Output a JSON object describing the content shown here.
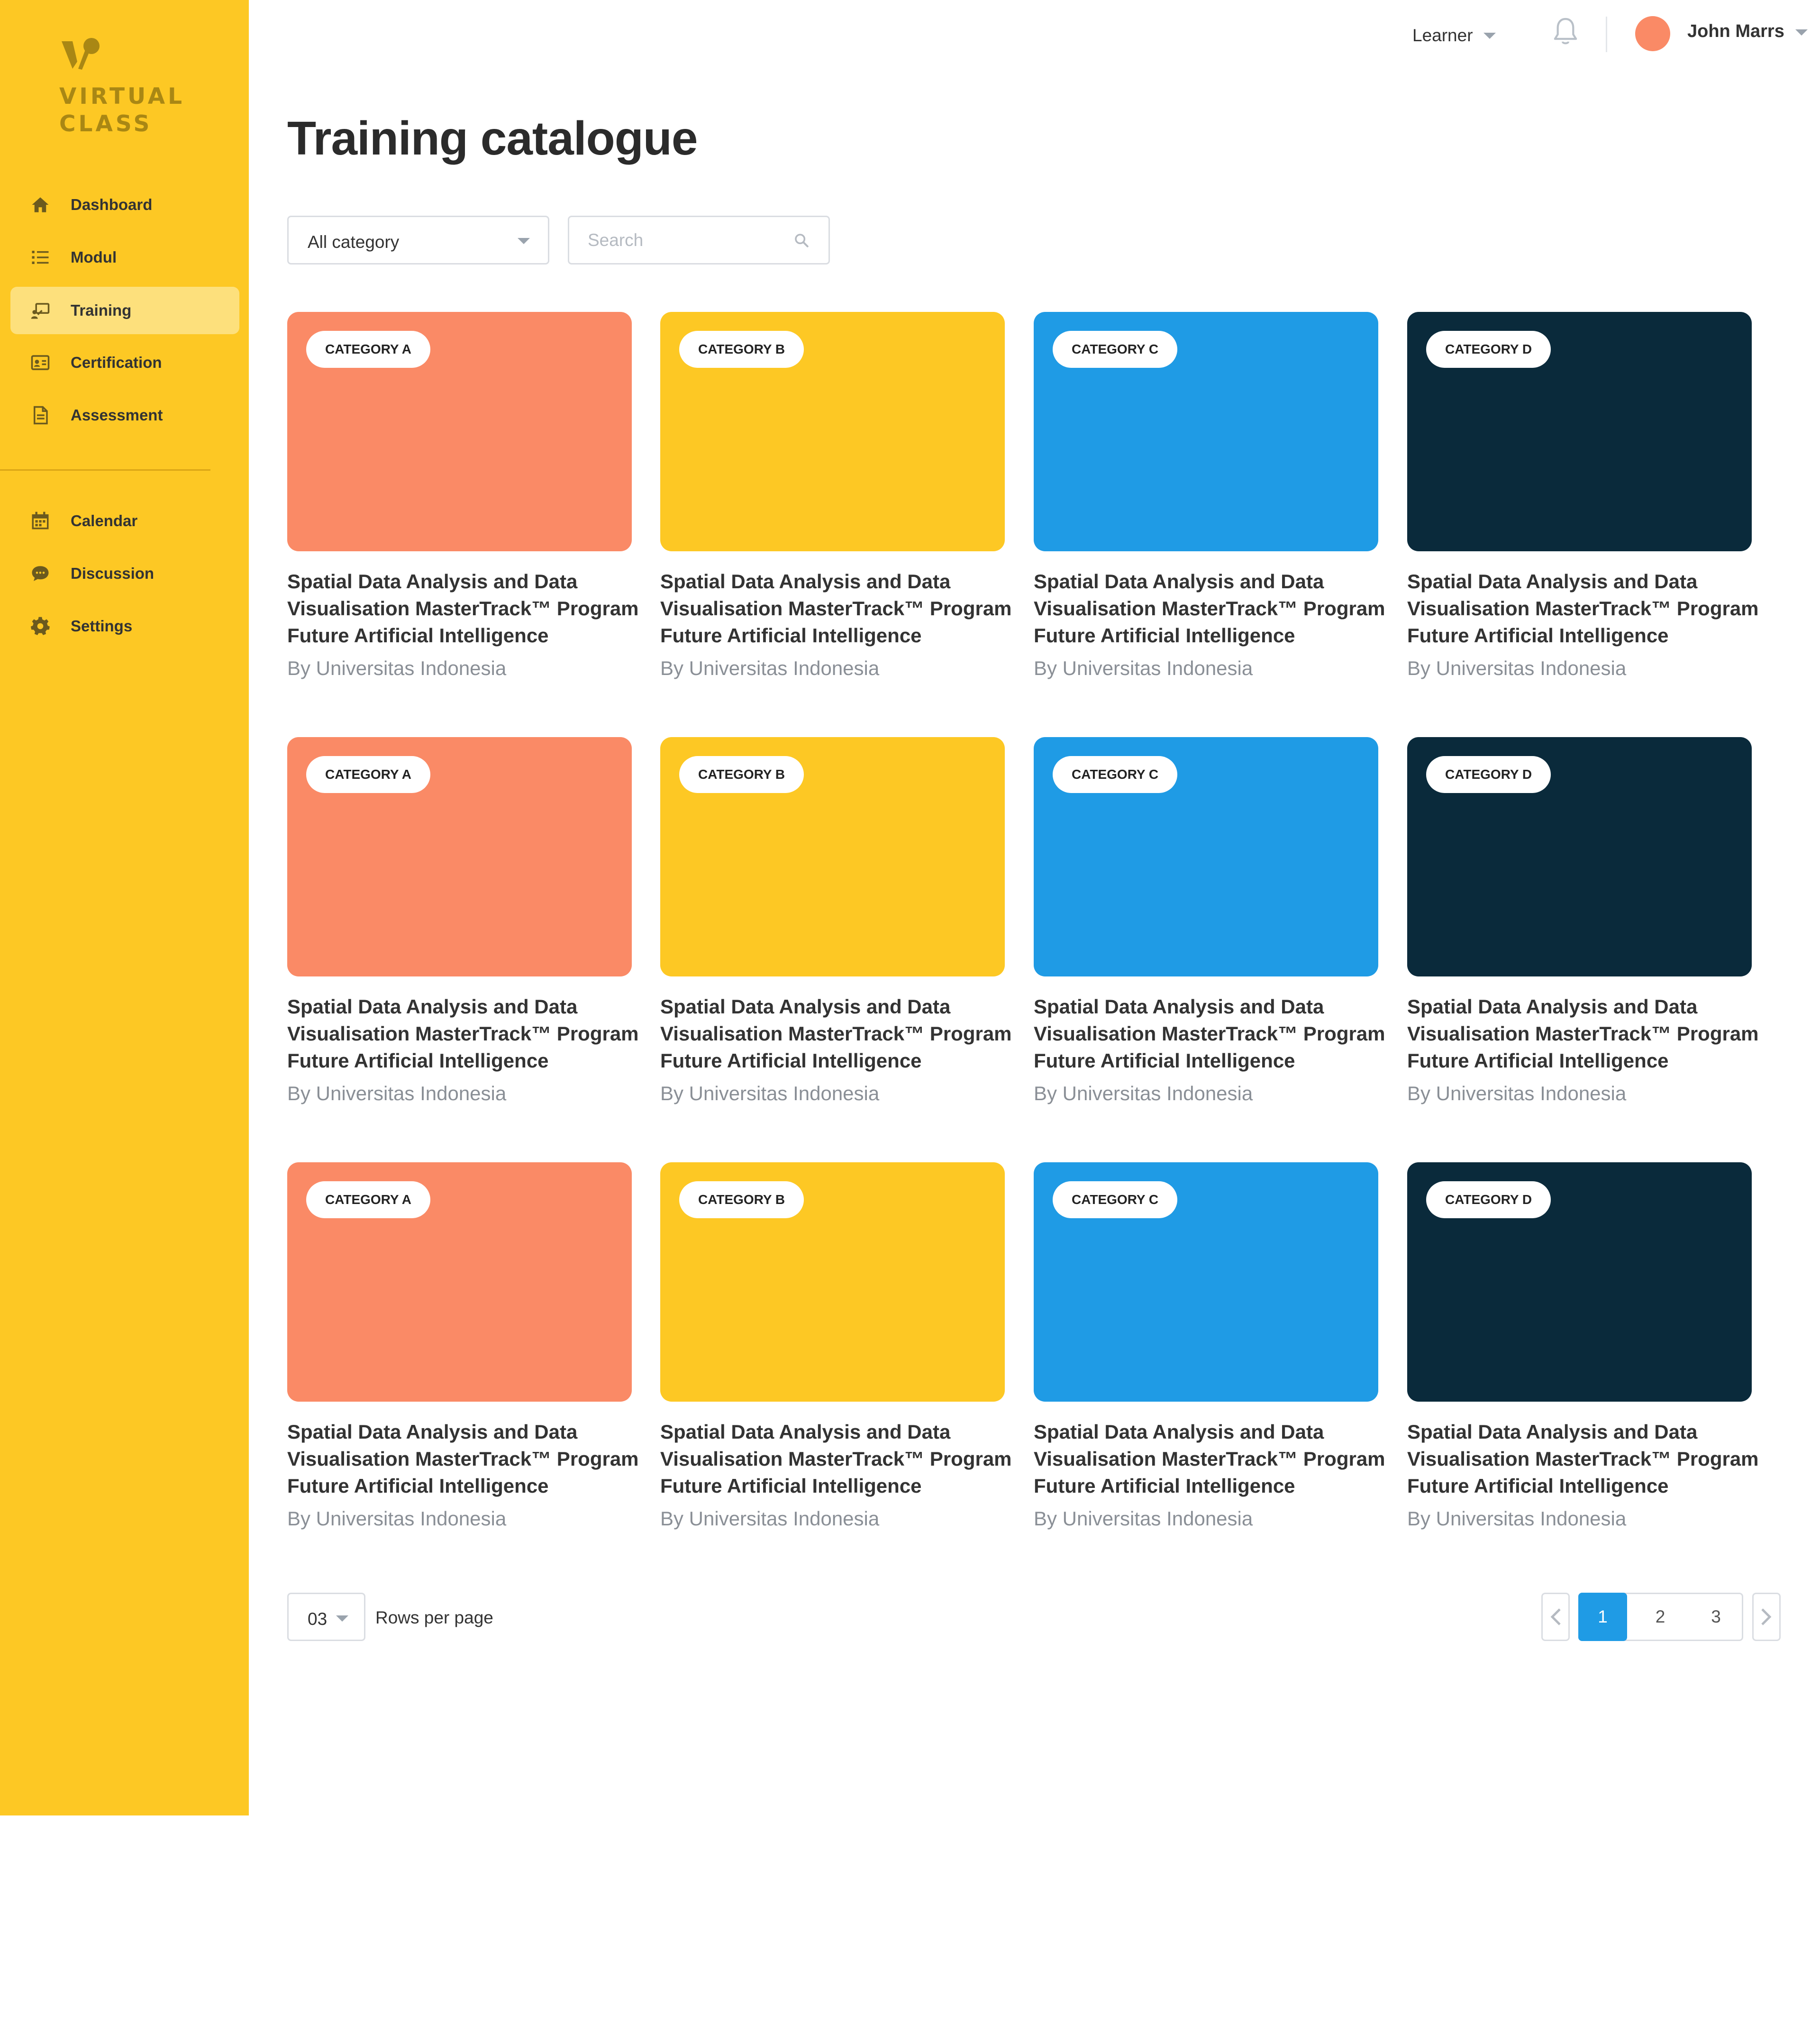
{
  "app": {
    "logo_text_line1": "VIRTUAL",
    "logo_text_line2": "CLASS"
  },
  "sidebar": {
    "items": [
      {
        "label": "Dashboard",
        "icon": "home-icon"
      },
      {
        "label": "Modul",
        "icon": "list-icon"
      },
      {
        "label": "Training",
        "icon": "training-icon",
        "active": true
      },
      {
        "label": "Certification",
        "icon": "certificate-icon"
      },
      {
        "label": "Assessment",
        "icon": "document-icon"
      },
      {
        "label": "Calendar",
        "icon": "calendar-icon"
      },
      {
        "label": "Discussion",
        "icon": "chat-icon"
      },
      {
        "label": "Settings",
        "icon": "gear-icon"
      }
    ]
  },
  "header": {
    "role": "Learner",
    "user_name": "John Marrs"
  },
  "main": {
    "title": "Training catalogue",
    "filter_category": "All category",
    "search_placeholder": "Search"
  },
  "cards": [
    {
      "category": "CATEGORY A",
      "title_l1": "Spatial Data Analysis and Data",
      "title_l2": "Visualisation MasterTrack™ Program",
      "title_l3": "Future Artificial Intelligence",
      "author": "By Universitas Indonesia"
    },
    {
      "category": "CATEGORY B",
      "title_l1": "Spatial Data Analysis and Data",
      "title_l2": "Visualisation MasterTrack™ Program",
      "title_l3": "Future Artificial Intelligence",
      "author": "By Universitas Indonesia"
    },
    {
      "category": "CATEGORY C",
      "title_l1": "Spatial Data Analysis and Data",
      "title_l2": "Visualisation MasterTrack™ Program",
      "title_l3": "Future Artificial Intelligence",
      "author": "By Universitas Indonesia"
    },
    {
      "category": "CATEGORY D",
      "title_l1": "Spatial Data Analysis and Data",
      "title_l2": "Visualisation MasterTrack™ Program",
      "title_l3": "Future Artificial Intelligence",
      "author": "By Universitas Indonesia"
    },
    {
      "category": "CATEGORY A",
      "title_l1": "Spatial Data Analysis and Data",
      "title_l2": "Visualisation MasterTrack™ Program",
      "title_l3": "Future Artificial Intelligence",
      "author": "By Universitas Indonesia"
    },
    {
      "category": "CATEGORY B",
      "title_l1": "Spatial Data Analysis and Data",
      "title_l2": "Visualisation MasterTrack™ Program",
      "title_l3": "Future Artificial Intelligence",
      "author": "By Universitas Indonesia"
    },
    {
      "category": "CATEGORY C",
      "title_l1": "Spatial Data Analysis and Data",
      "title_l2": "Visualisation MasterTrack™ Program",
      "title_l3": "Future Artificial Intelligence",
      "author": "By Universitas Indonesia"
    },
    {
      "category": "CATEGORY D",
      "title_l1": "Spatial Data Analysis and Data",
      "title_l2": "Visualisation MasterTrack™ Program",
      "title_l3": "Future Artificial Intelligence",
      "author": "By Universitas Indonesia"
    },
    {
      "category": "CATEGORY A",
      "title_l1": "Spatial Data Analysis and Data",
      "title_l2": "Visualisation MasterTrack™ Program",
      "title_l3": "Future Artificial Intelligence",
      "author": "By Universitas Indonesia"
    },
    {
      "category": "CATEGORY B",
      "title_l1": "Spatial Data Analysis and Data",
      "title_l2": "Visualisation MasterTrack™ Program",
      "title_l3": "Future Artificial Intelligence",
      "author": "By Universitas Indonesia"
    },
    {
      "category": "CATEGORY C",
      "title_l1": "Spatial Data Analysis and Data",
      "title_l2": "Visualisation MasterTrack™ Program",
      "title_l3": "Future Artificial Intelligence",
      "author": "By Universitas Indonesia"
    },
    {
      "category": "CATEGORY D",
      "title_l1": "Spatial Data Analysis and Data",
      "title_l2": "Visualisation MasterTrack™ Program",
      "title_l3": "Future Artificial Intelligence",
      "author": "By Universitas Indonesia"
    }
  ],
  "pagination": {
    "rows_value": "03",
    "rows_label": "Rows per page",
    "pages": [
      "1",
      "2",
      "3"
    ],
    "current_page": "1"
  },
  "colors": {
    "sidebar_bg": "#FDC824",
    "sidebar_active": "#FDE07C",
    "category_a": "#FA8A66",
    "category_b": "#FDC824",
    "category_c": "#1F9BE5",
    "category_d": "#0A2A3B",
    "accent": "#1F9BE5"
  }
}
